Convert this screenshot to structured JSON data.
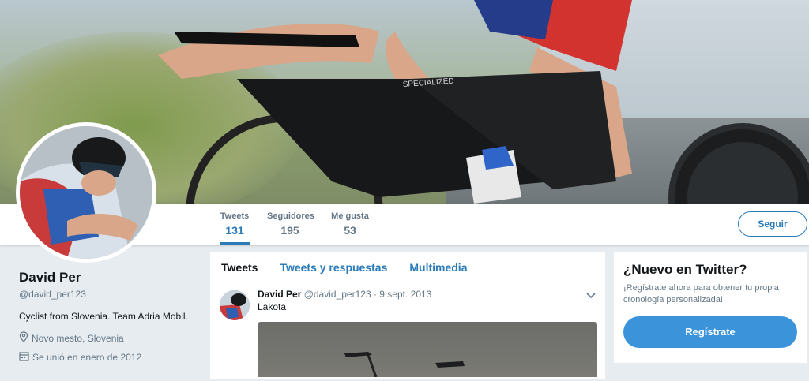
{
  "profile": {
    "name": "David Per",
    "handle": "@david_per123",
    "bio": "Cyclist from Slovenia. Team Adria Mobil.",
    "location": "Novo mesto, Slovenia",
    "joined": "Se unió en enero de 2012"
  },
  "stats": [
    {
      "label": "Tweets",
      "value": "131"
    },
    {
      "label": "Seguidores",
      "value": "195"
    },
    {
      "label": "Me gusta",
      "value": "53"
    }
  ],
  "follow_label": "Seguir",
  "timeline_tabs": [
    "Tweets",
    "Tweets y respuestas",
    "Multimedia"
  ],
  "tweet": {
    "name": "David Per",
    "handle": "@david_per123",
    "date": "· 9 sept. 2013",
    "text": "Lakota"
  },
  "signup": {
    "title": "¿Nuevo en Twitter?",
    "text": "¡Regístrate ahora para obtener tu propia cronología personalizada!",
    "button": "Regístrate"
  },
  "colors": {
    "accent": "#2b7bb9",
    "button": "#3b94d9",
    "background": "#e6ecf0"
  }
}
